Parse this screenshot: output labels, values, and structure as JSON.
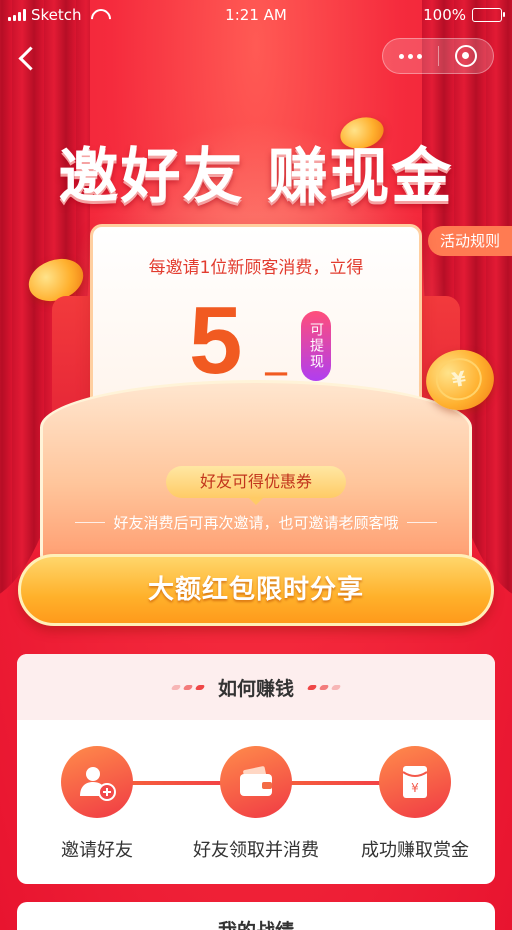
{
  "status_bar": {
    "carrier": "Sketch",
    "time": "1:21 AM",
    "battery": "100%"
  },
  "header": {
    "headline": "邀好友 赚现金",
    "rules_label": "活动规则"
  },
  "reward_card": {
    "line1": "每邀请1位新顾客消费，立得",
    "amount": "5",
    "unit": "元",
    "tag": "可提现"
  },
  "coupon_pill": "好友可得优惠券",
  "subline": "好友消费后可再次邀请，也可邀请老顾客哦",
  "share_button": "大额红包限时分享",
  "how_section": {
    "title": "如何赚钱",
    "steps": [
      {
        "label": "邀请好友",
        "icon": "add-user-icon"
      },
      {
        "label": "好友领取并消费",
        "icon": "wallet-icon"
      },
      {
        "label": "成功赚取赏金",
        "icon": "red-envelope-icon"
      }
    ]
  },
  "record_section": {
    "title": "我的战绩"
  },
  "colors": {
    "primary_red": "#f52b3d",
    "accent_orange": "#f15a21",
    "button_gold": "#ffb12b"
  }
}
